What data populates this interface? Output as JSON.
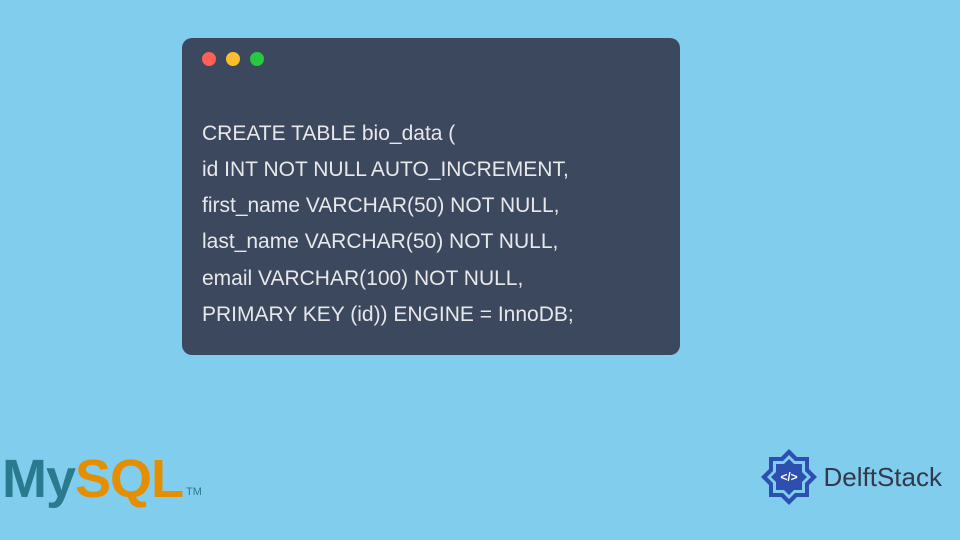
{
  "code": {
    "lines": [
      "CREATE TABLE bio_data (",
      "id INT NOT NULL AUTO_INCREMENT,",
      "first_name VARCHAR(50) NOT NULL,",
      "last_name VARCHAR(50) NOT NULL,",
      "email VARCHAR(100) NOT NULL,",
      "PRIMARY KEY (id)) ENGINE = InnoDB;"
    ]
  },
  "mysql": {
    "my": "My",
    "sql": "SQL",
    "tm": "TM"
  },
  "delftstack": {
    "label": "DelftStack"
  },
  "colors": {
    "bg": "#80cdee",
    "window": "#3c485e",
    "code_text": "#e8e8ea",
    "mysql_my": "#2a7a8f",
    "mysql_sql": "#e48e00",
    "ds_blue": "#2c4fb0"
  }
}
